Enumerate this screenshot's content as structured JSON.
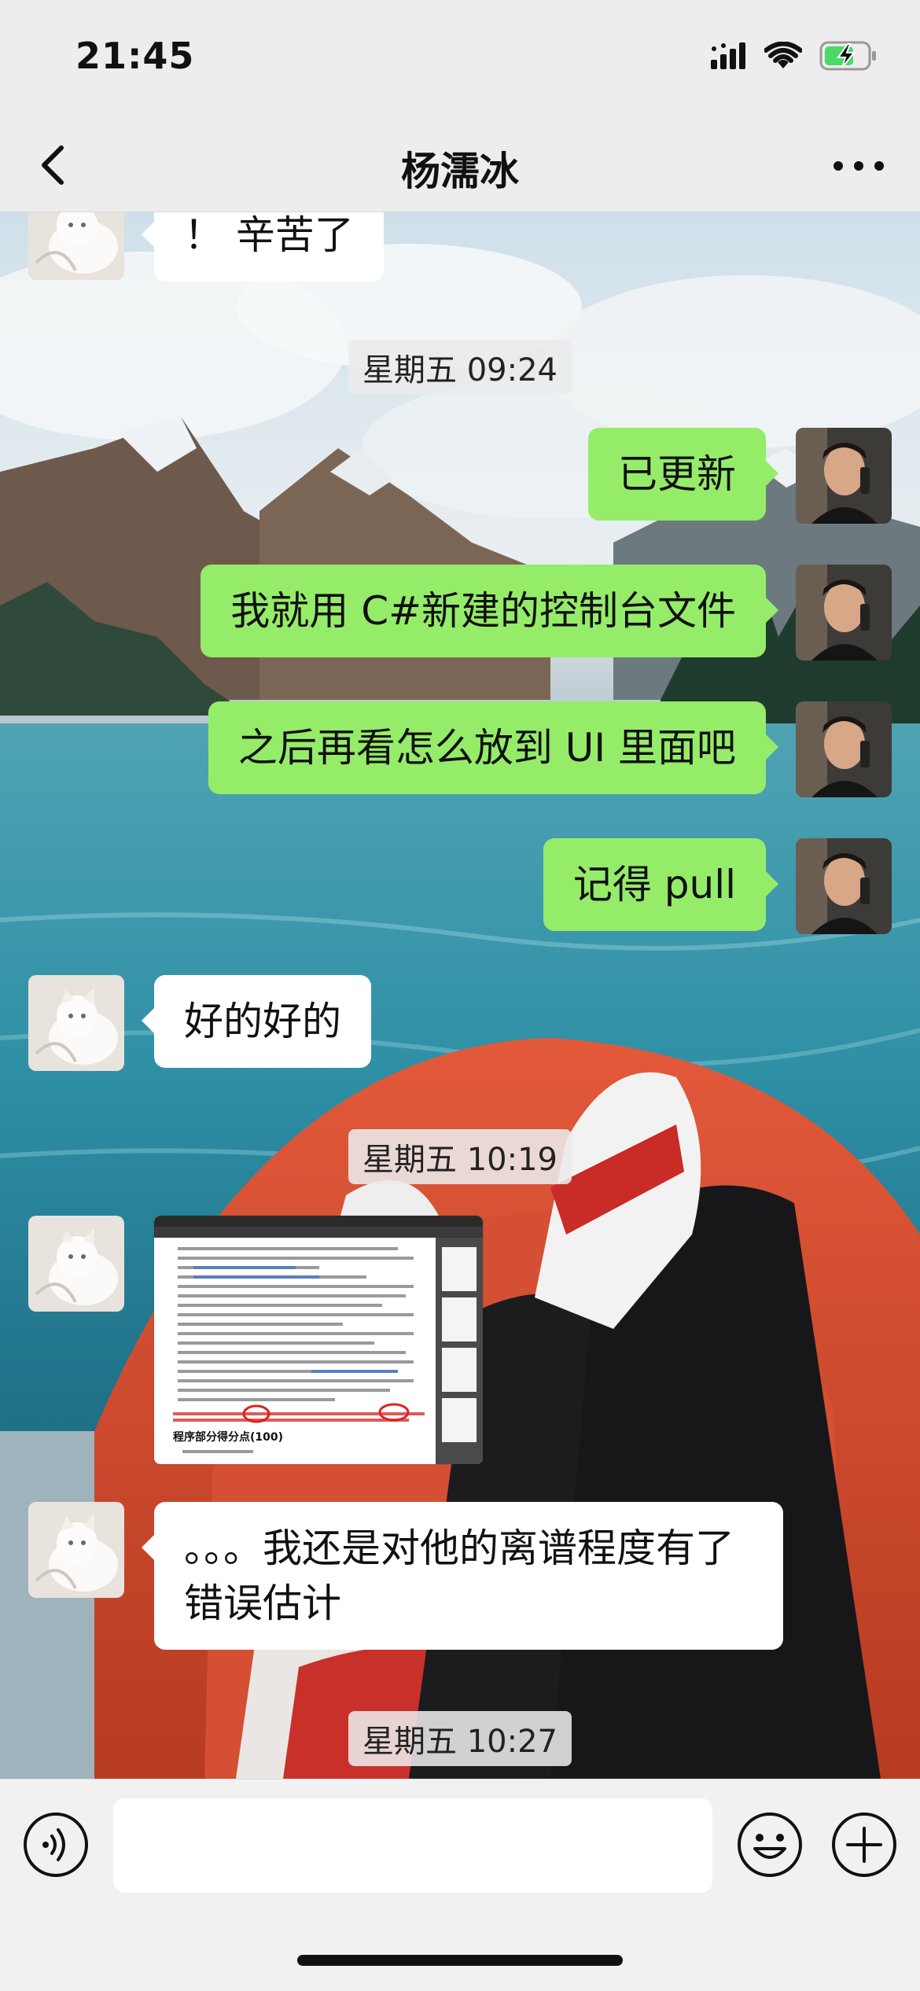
{
  "status": {
    "time": "21:45",
    "icons": [
      "signal-icon",
      "wifi-icon",
      "battery-charging-icon"
    ]
  },
  "nav": {
    "title": "杨濡冰",
    "back_icon": "chevron-left-icon",
    "more_icon": "more-dots-icon"
  },
  "messages": [
    {
      "side": "in",
      "type": "text",
      "text": "！ 辛苦了"
    },
    {
      "type": "timestamp",
      "text": "星期五 09:24"
    },
    {
      "side": "out",
      "type": "text",
      "text": "已更新"
    },
    {
      "side": "out",
      "type": "text",
      "text": "我就用 C#新建的控制台文件"
    },
    {
      "side": "out",
      "type": "text",
      "text": "之后再看怎么放到 UI 里面吧"
    },
    {
      "side": "out",
      "type": "text",
      "text": "记得 pull"
    },
    {
      "side": "in",
      "type": "text",
      "text": "好的好的"
    },
    {
      "type": "timestamp",
      "text": "星期五 10:19"
    },
    {
      "side": "in",
      "type": "image",
      "caption": "程序部分得分点(100)"
    },
    {
      "side": "in",
      "type": "text",
      "text": "。。。我还是对他的离谱程度有了错误估计"
    },
    {
      "type": "timestamp",
      "text": "星期五 10:27"
    }
  ],
  "input": {
    "placeholder": "",
    "value": ""
  },
  "colors": {
    "outgoing_bubble": "#95ec69",
    "incoming_bubble": "#ffffff",
    "bar_background": "#ededed"
  }
}
